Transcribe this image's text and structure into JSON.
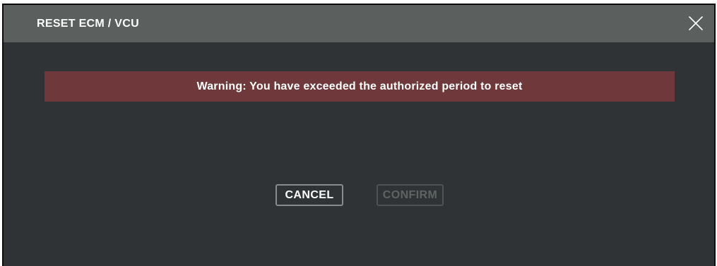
{
  "dialog": {
    "title": "RESET ECM / VCU",
    "close_icon": "close-icon",
    "warning": "Warning: You have exceeded the authorized period to reset",
    "buttons": {
      "cancel_label": "CANCEL",
      "confirm_label": "CONFIRM"
    }
  },
  "colors": {
    "background": "#2f3336",
    "titlebar": "#5b605e",
    "warning_banner": "#6f393b",
    "text": "#ffffff",
    "disabled_text": "#5f6462"
  }
}
